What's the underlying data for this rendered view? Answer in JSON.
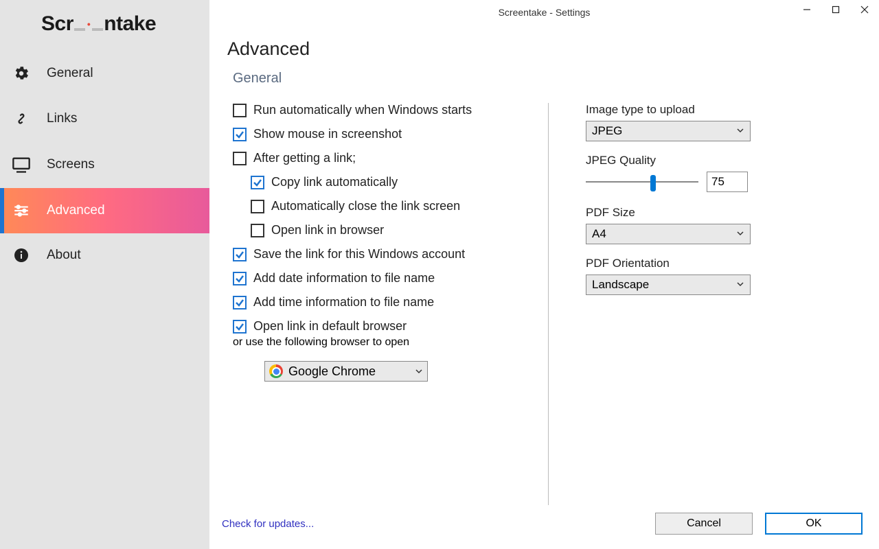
{
  "window": {
    "title": "Screentake - Settings"
  },
  "logo": {
    "pre": "Scr",
    "post": "ntake"
  },
  "sidebar": {
    "items": [
      {
        "label": "General"
      },
      {
        "label": "Links"
      },
      {
        "label": "Screens"
      },
      {
        "label": "Advanced"
      },
      {
        "label": "About"
      }
    ]
  },
  "page": {
    "title": "Advanced",
    "section": "General"
  },
  "checks": {
    "run_auto": "Run automatically when Windows starts",
    "show_mouse": "Show mouse in screenshot",
    "after_link": "After getting a link;",
    "copy_link": "Copy link automatically",
    "auto_close": "Automatically close the link screen",
    "open_browser": "Open link in browser",
    "save_link": "Save the link for this Windows account",
    "add_date": "Add date information to file name",
    "add_time": "Add time information to file name",
    "open_default": "Open link in default browser",
    "open_default_sub": "or use the following browser to open"
  },
  "browser": {
    "selected": "Google Chrome"
  },
  "right": {
    "image_type_label": "Image type to upload",
    "image_type_value": "JPEG",
    "jpeg_quality_label": "JPEG Quality",
    "jpeg_quality_value": "75",
    "jpeg_quality_percent": 60,
    "pdf_size_label": "PDF Size",
    "pdf_size_value": "A4",
    "pdf_orient_label": "PDF Orientation",
    "pdf_orient_value": "Landscape"
  },
  "footer": {
    "update": "Check for updates...",
    "cancel": "Cancel",
    "ok": "OK"
  }
}
